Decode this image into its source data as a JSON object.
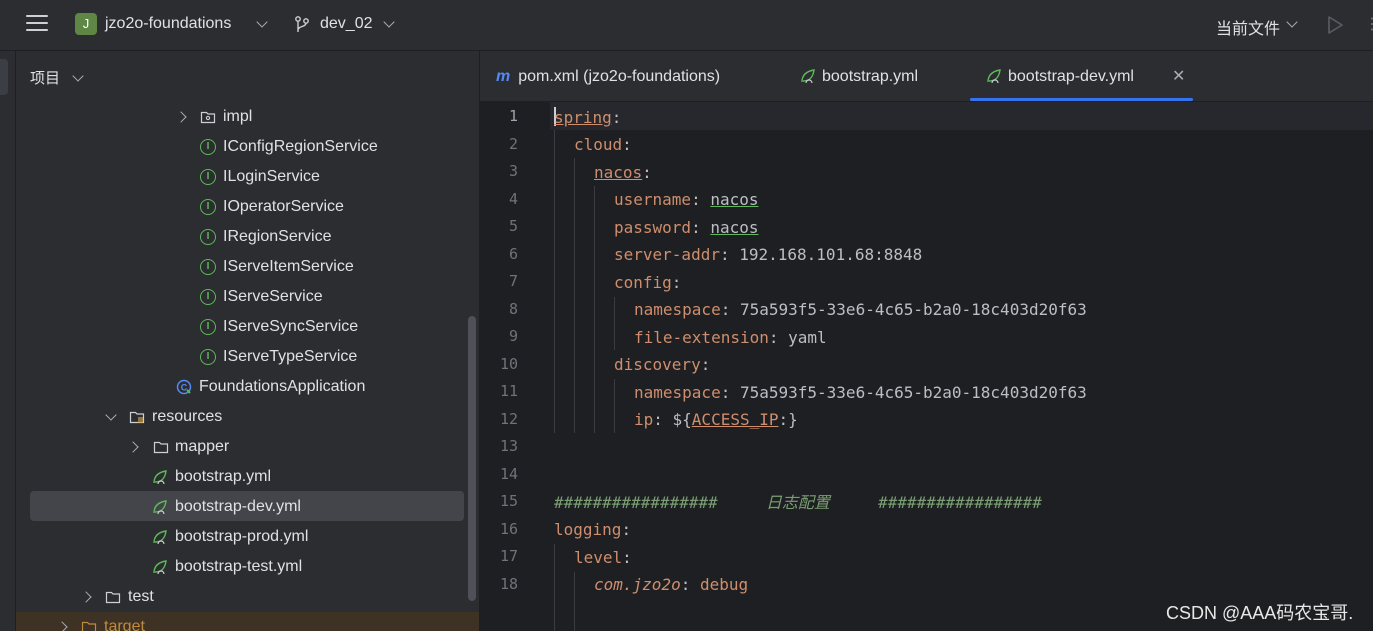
{
  "titlebar": {
    "project_badge": "J",
    "project_name": "jzo2o-foundations",
    "branch_name": "dev_02",
    "current_file_label": "当前文件",
    "icons": [
      "hamburger-menu-icon",
      "branch-icon",
      "run-icon"
    ]
  },
  "project_panel": {
    "title": "项目",
    "tree": [
      {
        "label": "impl",
        "type": "folder",
        "expanded": false
      },
      {
        "label": "IConfigRegionService",
        "type": "interface"
      },
      {
        "label": "ILoginService",
        "type": "interface"
      },
      {
        "label": "IOperatorService",
        "type": "interface"
      },
      {
        "label": "IRegionService",
        "type": "interface"
      },
      {
        "label": "IServeItemService",
        "type": "interface"
      },
      {
        "label": "IServeService",
        "type": "interface"
      },
      {
        "label": "IServeSyncService",
        "type": "interface"
      },
      {
        "label": "IServeTypeService",
        "type": "interface"
      },
      {
        "label": "FoundationsApplication",
        "type": "spring-boot-app"
      },
      {
        "label": "resources",
        "type": "resources-folder",
        "expanded": true
      },
      {
        "label": "mapper",
        "type": "folder",
        "expanded": false
      },
      {
        "label": "bootstrap.yml",
        "type": "yaml"
      },
      {
        "label": "bootstrap-dev.yml",
        "type": "yaml",
        "selected": true
      },
      {
        "label": "bootstrap-prod.yml",
        "type": "yaml"
      },
      {
        "label": "bootstrap-test.yml",
        "type": "yaml"
      },
      {
        "label": "test",
        "type": "folder",
        "expanded": false
      },
      {
        "label": "target",
        "type": "excluded-folder",
        "expanded": false
      }
    ]
  },
  "tabs": [
    {
      "label": "pom.xml (jzo2o-foundations)",
      "icon": "maven-icon",
      "active": false
    },
    {
      "label": "bootstrap.yml",
      "icon": "spring-yaml-icon",
      "active": false
    },
    {
      "label": "bootstrap-dev.yml",
      "icon": "spring-yaml-icon",
      "active": true
    }
  ],
  "editor": {
    "line_numbers": [
      "1",
      "2",
      "3",
      "4",
      "5",
      "6",
      "7",
      "8",
      "9",
      "10",
      "11",
      "12",
      "13",
      "14",
      "15",
      "16",
      "17",
      "18"
    ],
    "lines": [
      {
        "key": "spring",
        "sep": ":",
        "val": ""
      },
      {
        "key": "cloud",
        "sep": ":",
        "val": ""
      },
      {
        "key": "nacos",
        "sep": ":",
        "val": ""
      },
      {
        "key": "username",
        "sep": ": ",
        "val": "nacos"
      },
      {
        "key": "password",
        "sep": ": ",
        "val": "nacos"
      },
      {
        "key": "server-addr",
        "sep": ": ",
        "val": "192.168.101.68:8848"
      },
      {
        "key": "config",
        "sep": ":",
        "val": ""
      },
      {
        "key": "namespace",
        "sep": ": ",
        "val": "75a593f5-33e6-4c65-b2a0-18c403d20f63"
      },
      {
        "key": "file-extension",
        "sep": ": ",
        "val": "yaml"
      },
      {
        "key": "discovery",
        "sep": ":",
        "val": ""
      },
      {
        "key": "namespace",
        "sep": ": ",
        "val": "75a593f5-33e6-4c65-b2a0-18c403d20f63"
      },
      {
        "key": "ip",
        "sep": ": ",
        "val_prefix": "${",
        "val_link": "ACCESS_IP",
        "val_suffix": ":}"
      },
      {
        "text": ""
      },
      {
        "text": ""
      },
      {
        "comment": "#################     日志配置     #################"
      },
      {
        "key": "logging",
        "sep": ":",
        "val": ""
      },
      {
        "key": "level",
        "sep": ":",
        "val": ""
      },
      {
        "key": "com.jzo2o",
        "sep": ": ",
        "val": "debug"
      }
    ]
  },
  "watermark": "CSDN @AAA码农宝哥."
}
